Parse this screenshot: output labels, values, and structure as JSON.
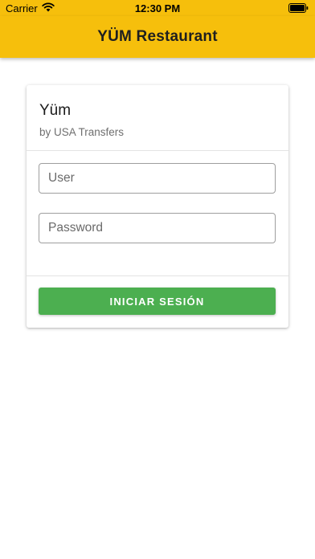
{
  "status_bar": {
    "carrier": "Carrier",
    "time": "12:30 PM",
    "wifi_icon": "wifi-icon",
    "battery_icon": "battery-full-icon"
  },
  "app_bar": {
    "title": "YÜM Restaurant",
    "background_color": "#f6bf0c"
  },
  "login_card": {
    "title": "Yüm",
    "subtitle": "by USA Transfers",
    "user_field": {
      "placeholder": "User",
      "value": ""
    },
    "password_field": {
      "placeholder": "Password",
      "value": ""
    },
    "submit_label": "INICIAR SESIÓN",
    "submit_color": "#4caf50"
  }
}
